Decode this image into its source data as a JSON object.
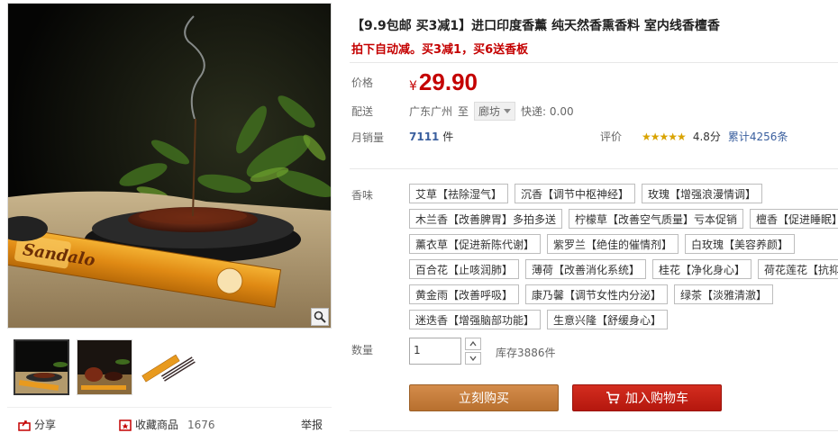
{
  "product": {
    "title": "【9.9包邮 买3减1】进口印度香薰 纯天然香熏香料 室内线香檀香",
    "subtitle": "拍下自动减。买3减1，买6送香板"
  },
  "price": {
    "label": "价格",
    "currency": "¥",
    "value": "29.90"
  },
  "shipping": {
    "label": "配送",
    "from": "广东广州",
    "to_word": "至",
    "to_city": "廊坊",
    "fee": "快递: 0.00"
  },
  "sales": {
    "label": "月销量",
    "count": "7111",
    "unit": "件"
  },
  "rating": {
    "label": "评价",
    "stars": "★★★★★",
    "score": "4.8分",
    "total": "累计4256条"
  },
  "scent": {
    "label": "香味",
    "rows": [
      [
        "艾草【祛除湿气】",
        "沉香【调节中枢神经】",
        "玫瑰【增强浪漫情调】"
      ],
      [
        "木兰香【改善脾胃】多拍多送",
        "柠檬草【改善空气质量】亏本促销",
        "檀香【促进睡眠】"
      ],
      [
        "薰衣草【促进新陈代谢】",
        "紫罗兰【绝佳的催情剂】",
        "白玫瑰【美容养颜】"
      ],
      [
        "百合花【止咳润肺】",
        "薄荷【改善消化系统】",
        "桂花【净化身心】",
        "荷花莲花【抗抑"
      ],
      [
        "黄金雨【改善呼吸】",
        "康乃馨【调节女性内分泌】",
        "绿茶【淡雅清澈】"
      ],
      [
        "迷迭香【增强脑部功能】",
        "生意兴隆【舒缓身心】"
      ]
    ]
  },
  "quantity": {
    "label": "数量",
    "value": "1",
    "stock": "库存3886件"
  },
  "buttons": {
    "buy_now": "立刻购买",
    "add_cart": "加入购物车"
  },
  "gallery": {
    "share": "分享",
    "favorite": "收藏商品",
    "favorite_count": "1676",
    "report": "举报",
    "package_text": "Sandalo"
  },
  "colors": {
    "price_red": "#c40000",
    "buy_button": "#c47c3d",
    "cart_button": "#c4231a",
    "link_blue": "#3a5f9e",
    "star_gold": "#d9a300"
  }
}
